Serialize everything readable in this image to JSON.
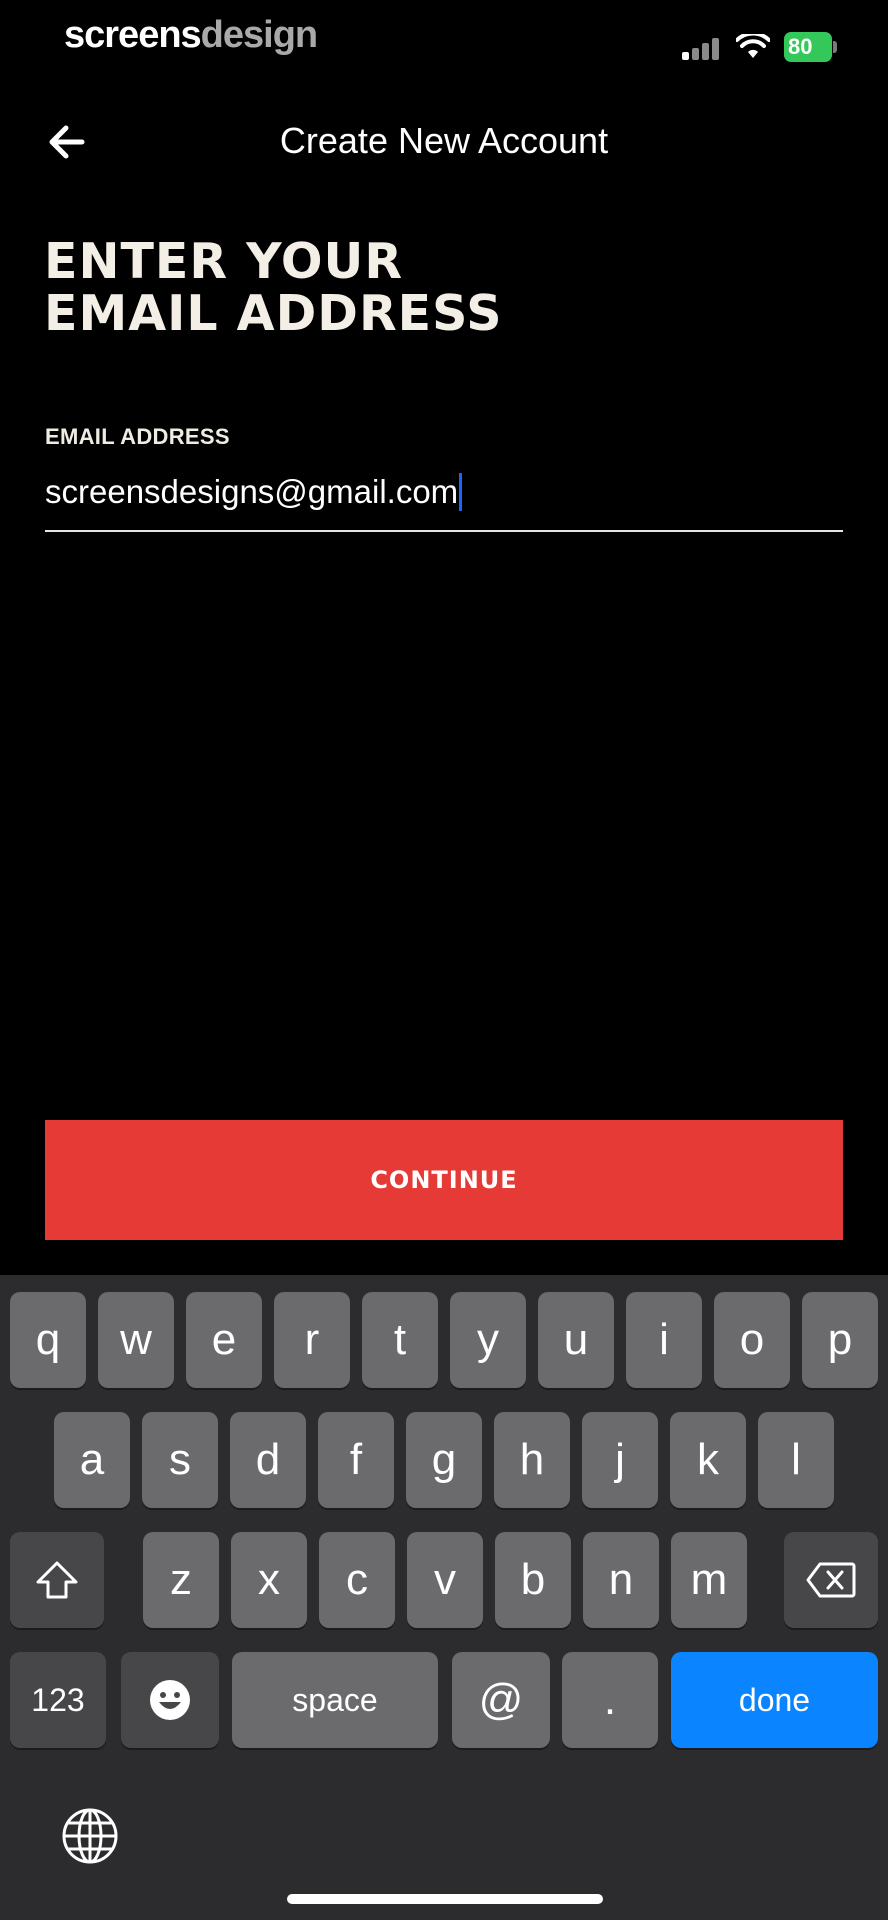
{
  "status_bar": {
    "watermark_part1": "screens",
    "watermark_part2": "design",
    "battery_percent": "80",
    "icons": [
      "signal-icon",
      "wifi-icon",
      "battery-icon"
    ]
  },
  "nav": {
    "back_icon": "arrow-left-icon",
    "title": "Create New Account"
  },
  "heading": {
    "line1": "ENTER YOUR",
    "line2": "EMAIL ADDRESS"
  },
  "email": {
    "label": "EMAIL ADDRESS",
    "value": "screensdesigns@gmail.com"
  },
  "continue_label": "CONTINUE",
  "keyboard": {
    "row1": [
      "q",
      "w",
      "e",
      "r",
      "t",
      "y",
      "u",
      "i",
      "o",
      "p"
    ],
    "row2": [
      "a",
      "s",
      "d",
      "f",
      "g",
      "h",
      "j",
      "k",
      "l"
    ],
    "row3": [
      "z",
      "x",
      "c",
      "v",
      "b",
      "n",
      "m"
    ],
    "shift_icon": "shift-icon",
    "backspace_icon": "backspace-icon",
    "numbers_label": "123",
    "emoji_icon": "emoji-icon",
    "space_label": "space",
    "at_label": "@",
    "dot_label": ".",
    "done_label": "done",
    "globe_icon": "globe-icon"
  },
  "colors": {
    "accent": "#e53a35",
    "done_blue": "#0a84ff",
    "battery_green": "#34c759",
    "caret_blue": "#1a64ff"
  }
}
